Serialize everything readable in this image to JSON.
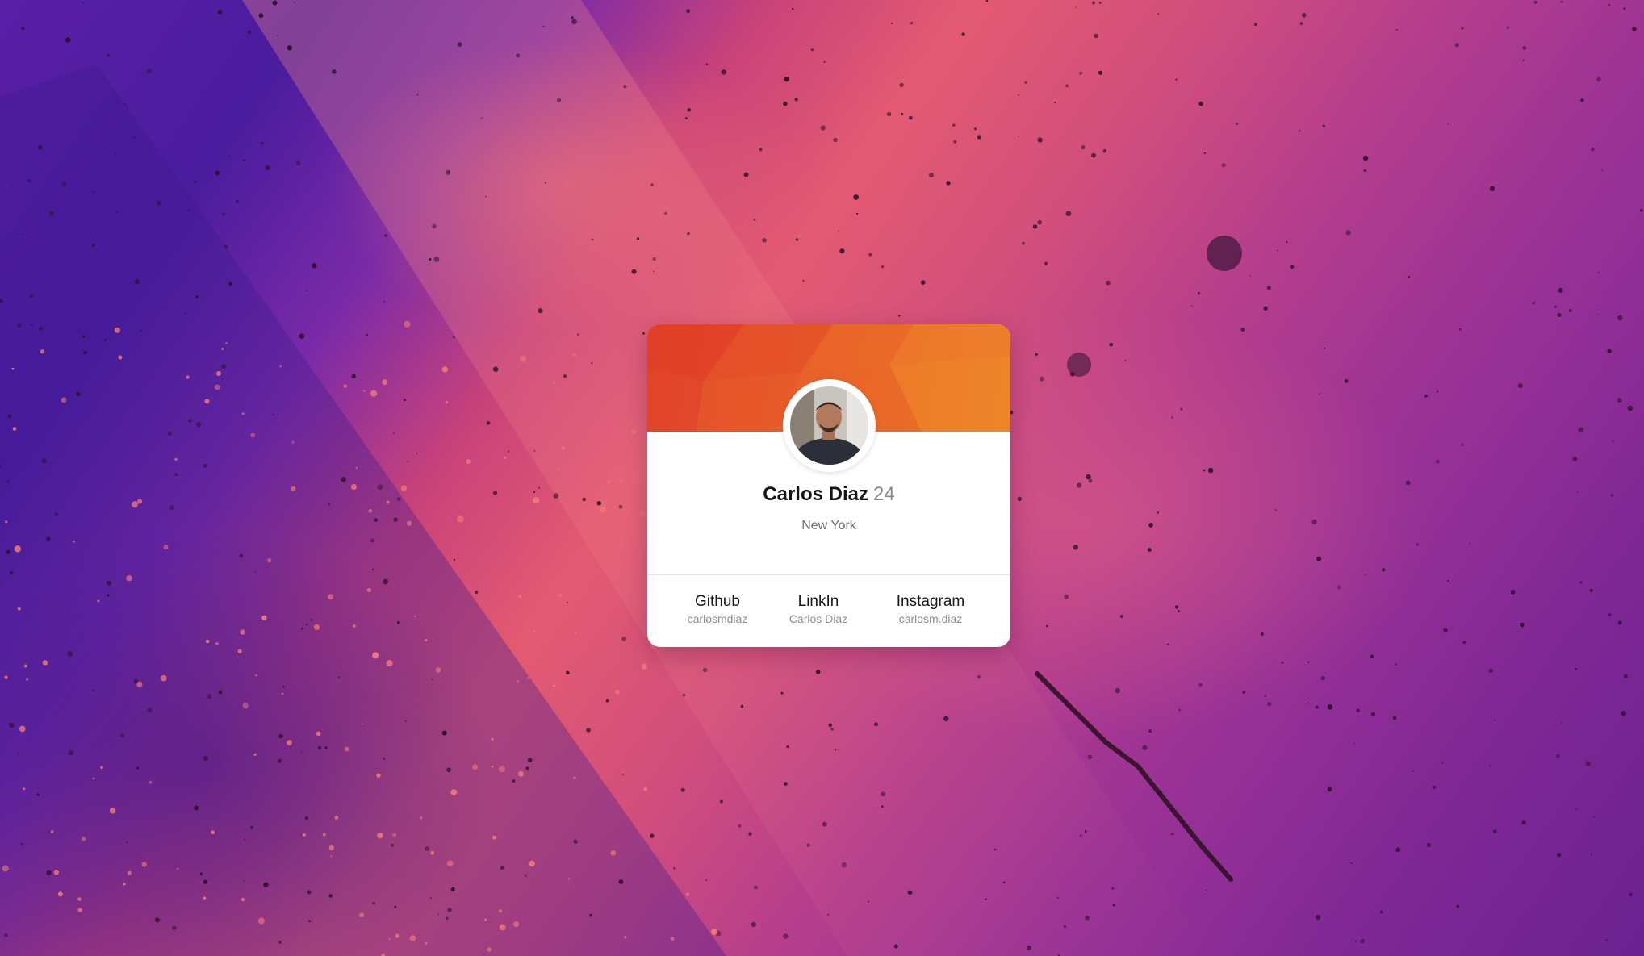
{
  "profile": {
    "name": "Carlos Diaz",
    "age": "24",
    "location": "New York"
  },
  "socials": [
    {
      "label": "Github",
      "handle": "carlosmdiaz",
      "icon": "github"
    },
    {
      "label": "LinkIn",
      "handle": "Carlos Diaz",
      "icon": "linkedin"
    },
    {
      "label": "Instagram",
      "handle": "carlosm.diaz",
      "icon": "instagram"
    }
  ],
  "colors": {
    "header_orange": "#e85a28",
    "card_bg": "#ffffff",
    "background_pink": "#e35a72",
    "background_purple": "#5a1fa6"
  }
}
